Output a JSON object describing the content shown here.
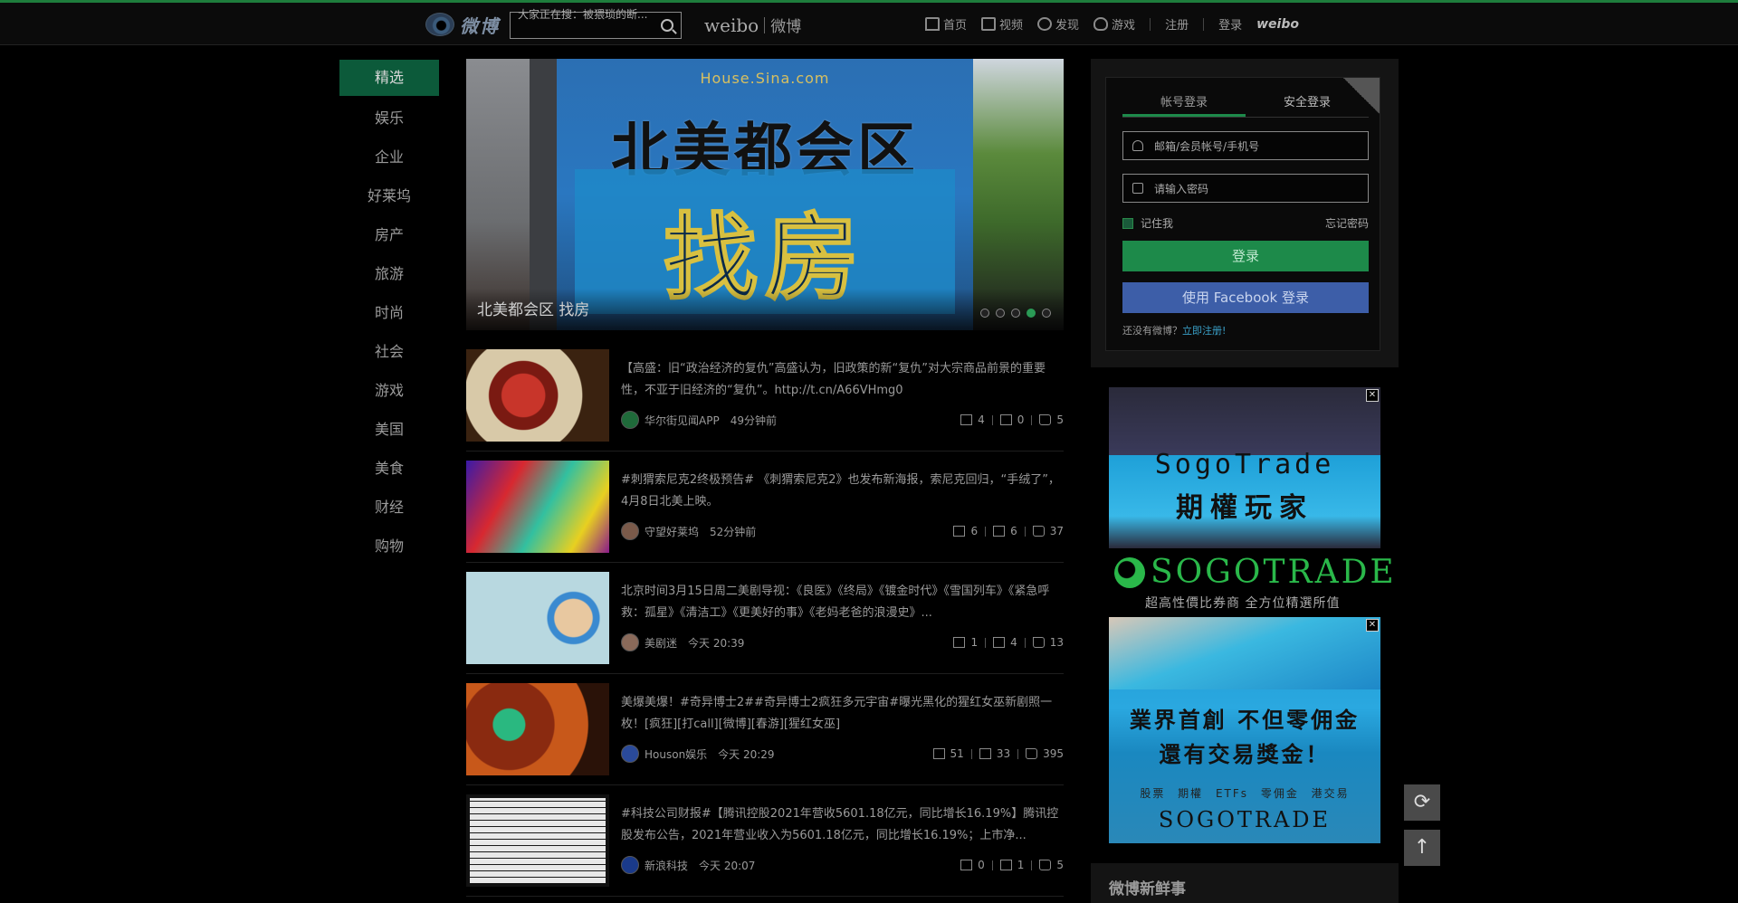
{
  "header": {
    "logo_text": "微博",
    "search_text": "大家正在搜：被猥琐的断...",
    "brand_en": "weibo",
    "brand_cn": "微博",
    "nav": [
      {
        "label": "首页",
        "icon": "home-icon"
      },
      {
        "label": "视频",
        "icon": "video-icon"
      },
      {
        "label": "发现",
        "icon": "discover-icon"
      },
      {
        "label": "游戏",
        "icon": "game-icon"
      }
    ],
    "register": "注册",
    "login": "登录",
    "weibo_en": "weibo"
  },
  "sidebar": {
    "items": [
      "精选",
      "娱乐",
      "企业",
      "好莱坞",
      "房产",
      "旅游",
      "时尚",
      "社会",
      "游戏",
      "美国",
      "美食",
      "财经",
      "购物"
    ]
  },
  "banner": {
    "site": "House.Sina.com",
    "title1": "北美都会区",
    "title2": "找房",
    "caption": "北美都会区 找房",
    "dots": 5,
    "active_dot": 3
  },
  "feed": [
    {
      "text": "【高盛：旧“政治经济的复仇”高盛认为，旧政策的新“复仇”对大宗商品前景的重要性，不亚于旧经济的“复仇”。http://t.cn/A66VHmg0",
      "source": "华尔街见闻APP",
      "time": "49分钟前",
      "reposts": "4",
      "comments": "0",
      "likes": "5"
    },
    {
      "text": "#刺猬索尼克2终极预告# 《刺猬索尼克2》也发布新海报，索尼克回归，“手绒了”，4月8日北美上映。",
      "source": "守望好莱坞",
      "time": "52分钟前",
      "reposts": "6",
      "comments": "6",
      "likes": "37"
    },
    {
      "text": "北京时间3月15日周二美剧导视：《良医》《终局》《镀金时代》《雪国列车》《紧急呼救：孤星》《清洁工》《更美好的事》《老妈老爸的浪漫史》...",
      "source": "美剧迷",
      "time": "今天 20:39",
      "reposts": "1",
      "comments": "4",
      "likes": "13"
    },
    {
      "text": "美爆美爆！#奇异博士2##奇异博士2疯狂多元宇宙#曝光黑化的猩红女巫新剧照一枚！[疯狂][打call][微博][春游][猩红女巫]",
      "source": "Houson娱乐",
      "time": "今天 20:29",
      "reposts": "51",
      "comments": "33",
      "likes": "395"
    },
    {
      "text": "#科技公司财报#【腾讯控股2021年营收5601.18亿元，同比增长16.19%】腾讯控股发布公告，2021年营业收入为5601.18亿元，同比增长16.19%；上市净...",
      "source": "新浪科技",
      "time": "今天 20:07",
      "reposts": "0",
      "comments": "1",
      "likes": "5"
    }
  ],
  "login": {
    "tab_account": "帐号登录",
    "tab_secure": "安全登录",
    "username_placeholder": "邮箱/会员帐号/手机号",
    "password_placeholder": "请输入密码",
    "remember": "记住我",
    "forgot": "忘记密码",
    "login_button": "登录",
    "facebook_button": "使用 Facebook 登录",
    "no_account": "还没有微博？",
    "register_link": "立即注册!"
  },
  "ads": {
    "ad1_brand": "SogoTrade",
    "ad1_slogan": "期權玩家",
    "logo_band": "SOGOTRADE",
    "logo_tag": "超高性價比券商 全方位精選所值",
    "ad2_line1": "業界首創 不但零佣金",
    "ad2_line2": "還有交易獎金！",
    "ad2_features": "股票 期權 ETFs 零佣金 港交易",
    "ad2_foot": "SOGOTRADE",
    "close_label": "✕"
  },
  "section_title": "微博新鲜事",
  "float_buttons": {
    "refresh": "⟳",
    "top": "↑"
  }
}
